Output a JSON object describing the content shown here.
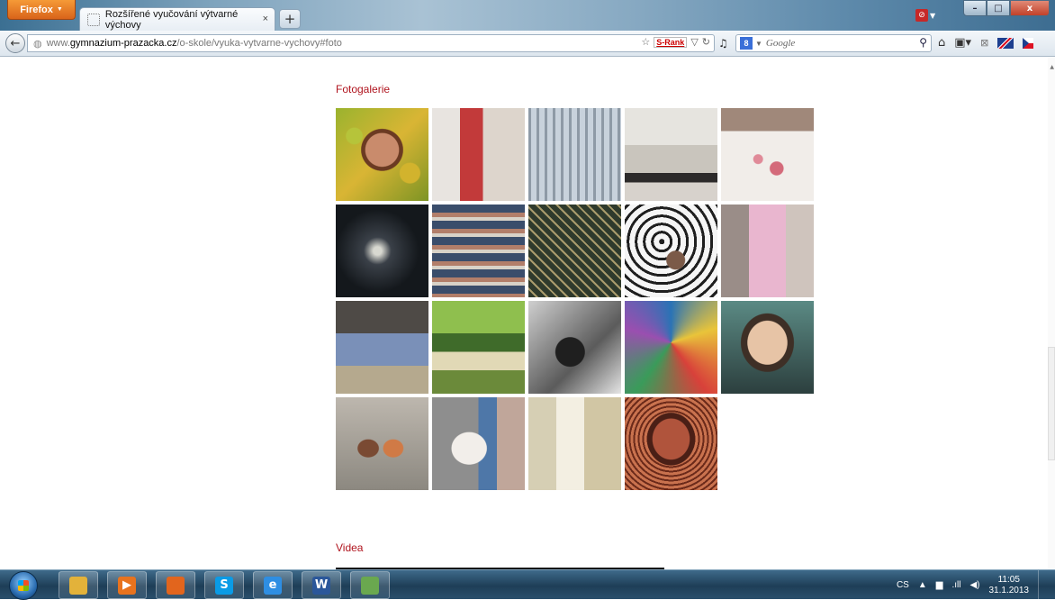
{
  "browser": {
    "menu_label": "Firefox",
    "tab_title": "Rozšířené vyučování výtvarné výchovy",
    "tab_close": "×",
    "new_tab": "+",
    "url_prefix": "www.",
    "url_host": "gymnazium-prazacka.cz",
    "url_path": "/o-skole/vyuka-vytvarne-vychovy#foto",
    "srank_label": "S-Rank",
    "search_placeholder": "Google",
    "window_min": "–",
    "window_max": "□",
    "window_close": "x"
  },
  "page": {
    "gallery_title": "Fotogalerie",
    "videos_title": "Videa"
  },
  "gallery": {
    "photos": [
      {
        "name": "photo-face-apples",
        "bg": "radial-gradient(circle at 50% 45%,#c98b6c 0 24%,#6b3a22 25% 30%,transparent 31%),radial-gradient(circle at 20% 30%,#b6c43a 0 8%,transparent 9%),radial-gradient(circle at 80% 70%,#d2b32d 0 10%,transparent 11%),linear-gradient(135deg,#9ab32e,#d9b534 50%,#7d9424)"
      },
      {
        "name": "photo-gallery-visitors",
        "bg": "linear-gradient(90deg,#e8e4e0 0 30%,#c23a3a 30% 55%,#ddd5cc 55%),linear-gradient(#0000,#8a6b4e)"
      },
      {
        "name": "photo-reichstag-dome",
        "bg": "repeating-linear-gradient(90deg,#8e9aa6 0 3px,#c8d2dc 3px 9px),linear-gradient(#9fb3c7,#5a6571)"
      },
      {
        "name": "photo-drawing-class",
        "bg": "linear-gradient(#e6e4df 0 40%,#c9c5bd 40% 70%,#2c2a2a 70% 80%,#d7d2cc 80%)"
      },
      {
        "name": "photo-painting-hand",
        "bg": "radial-gradient(circle at 60% 65%,#d46a7a 0 8%,transparent 9%),radial-gradient(circle at 40% 55%,#e08a98 0 6%,transparent 7%),linear-gradient(#a0887a 0 25%,#f1ede9 25%)"
      },
      {
        "name": "photo-dark-sculpture",
        "bg": "radial-gradient(circle at 45% 50%,#d8d8d0 0 6%,#3a4048 20%,#14181c 60%)"
      },
      {
        "name": "photo-students-auditorium",
        "bg": "repeating-linear-gradient(180deg,#3a4d6b 0 9px,#b27e6a 9px 14px,#d8d2c8 14px 18px)"
      },
      {
        "name": "photo-sticks-craft",
        "bg": "repeating-linear-gradient(45deg,#2f3a2c 0 6px,#a99b6c 6px 8px),linear-gradient(#e8e0cf,#4a5a3c)"
      },
      {
        "name": "photo-ink-hands",
        "bg": "radial-gradient(circle at 55% 60%,#7b5a48 0 12%,transparent 13%),repeating-radial-gradient(circle at 40% 40%,#1f1f1f 0 3px,#f5f5f5 3px 9px)"
      },
      {
        "name": "photo-pink-costume",
        "bg": "linear-gradient(90deg,#9a8d88 0 30%,#e9b6cf 30% 70%,#cfc4bd 70%)"
      },
      {
        "name": "photo-girl-drawing-wall",
        "bg": "linear-gradient(#4e4a46 0 35%,#7a90b8 35% 70%,#b5a98e 70%)"
      },
      {
        "name": "photo-outdoor-easels",
        "bg": "linear-gradient(#8fbf4e 0 35%,#3f6b2a 35% 55%,#e1d9b6 55% 75%,#6b8a3a 75%)"
      },
      {
        "name": "photo-bw-sculpture",
        "bg": "radial-gradient(circle at 45% 55%,#1f1f1f 0 20%,transparent 21%),linear-gradient(135deg,#cfcfcf,#5b5b5b 60%,#e5e5e5)"
      },
      {
        "name": "photo-colorful-mandala",
        "bg": "conic-gradient(from 0deg at 50% 45%,#2a73b5,#e9c43a,#d8413a,#3a9b5a,#9a4fb0,#2a73b5)"
      },
      {
        "name": "photo-mask-face",
        "bg": "radial-gradient(ellipse at 50% 45%,#e7c4a6 0 30%,#3e2f26 31% 40%,transparent 41%),linear-gradient(#5b8a84,#2c3f3e)"
      },
      {
        "name": "photo-glass-figures",
        "bg": "radial-gradient(ellipse at 35% 55%,#7a4a33 0 12%,transparent 13%),radial-gradient(ellipse at 62% 55%,#d07a46 0 12%,transparent 13%),linear-gradient(#bdb7ae,#8c8880)"
      },
      {
        "name": "photo-girl-plaster-bust",
        "bg": "radial-gradient(ellipse at 40% 55%,#f2eeea 0 22%,transparent 23%),linear-gradient(90deg,#8e8e8e 0 50%,#4e77a8 50% 70%,#c0a69a 70%)"
      },
      {
        "name": "photo-white-sculptures",
        "bg": "linear-gradient(90deg,#d6cfb4 0 30%,#f3efe2 30% 60%,#d1c6a4 60%),linear-gradient(#dad4c1,#b5aa88)"
      },
      {
        "name": "photo-painted-face",
        "bg": "radial-gradient(ellipse at 50% 45%,#b0543c 0 28%,#4a1f16 29% 36%,transparent 37%),repeating-radial-gradient(circle at 50% 45%,#6b2a1a 0 2px,#c9724e 2px 5px)"
      }
    ]
  },
  "taskbar": {
    "apps": [
      {
        "name": "explorer",
        "color": "#e3b23a",
        "glyph": ""
      },
      {
        "name": "media-player",
        "color": "#e8731e",
        "glyph": "▶"
      },
      {
        "name": "firefox",
        "color": "#e2651d",
        "glyph": ""
      },
      {
        "name": "skype",
        "color": "#0a9be6",
        "glyph": "S"
      },
      {
        "name": "internet-explorer",
        "color": "#2e8ee3",
        "glyph": "e"
      },
      {
        "name": "word",
        "color": "#2b579a",
        "glyph": "W"
      },
      {
        "name": "paint",
        "color": "#6aa84f",
        "glyph": ""
      }
    ],
    "language": "CS",
    "time": "11:05",
    "date": "31.1.2013"
  }
}
